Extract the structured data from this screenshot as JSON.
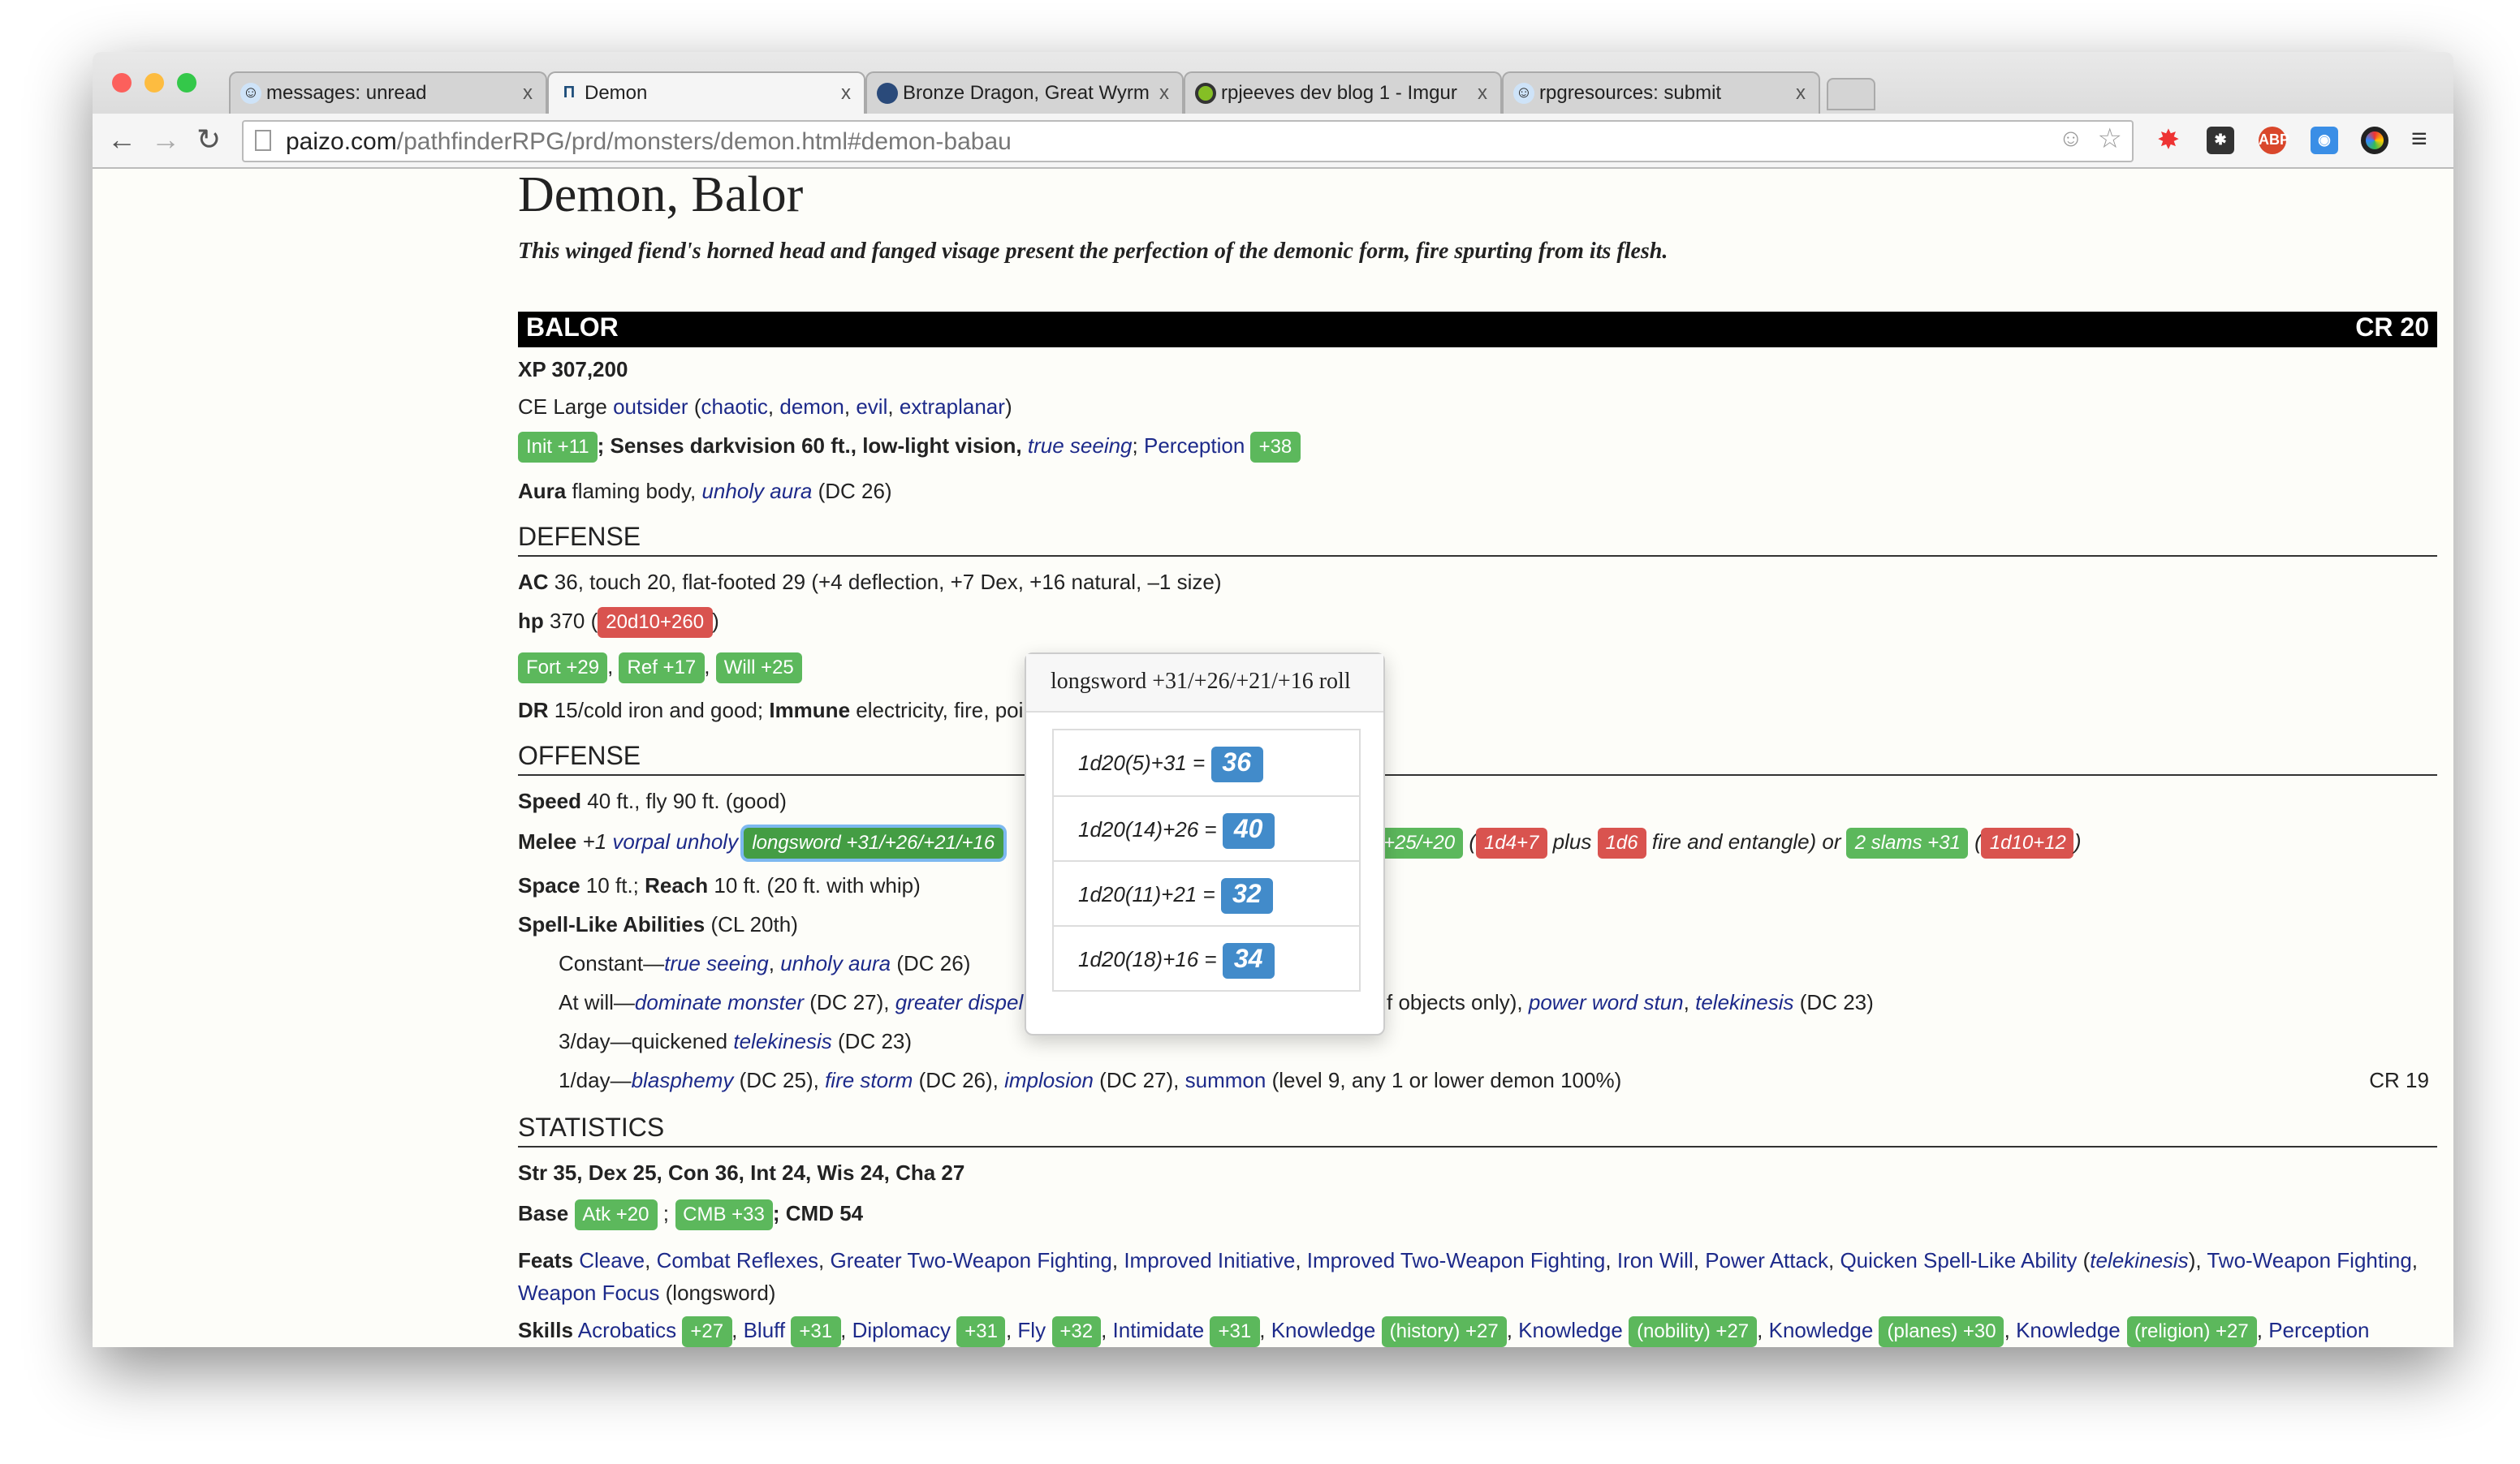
{
  "browser": {
    "tabs": [
      {
        "title": "messages: unread",
        "active": false
      },
      {
        "title": "Demon",
        "active": true
      },
      {
        "title": "Bronze Dragon, Great Wyrm",
        "active": false
      },
      {
        "title": "rpjeeves dev blog 1 - Imgur",
        "active": false
      },
      {
        "title": "rpgresources: submit",
        "active": false
      }
    ],
    "close": "x",
    "url_host": "paizo.com",
    "url_path": "/pathfinderRPG/prd/monsters/demon.html#demon-babau"
  },
  "page": {
    "title": "Demon, Balor",
    "subtitle": "This winged fiend's horned head and fanged visage present the perfection of the demonic form, fire spurting from its flesh.",
    "name": "BALOR",
    "cr": "CR 20",
    "xp": "XP 307,200",
    "type_pre": "CE Large ",
    "type": "outsider",
    "sub": [
      "chaotic",
      "demon",
      "evil",
      "extraplanar"
    ],
    "init": "Init +11",
    "senses": "; Senses darkvision 60 ft., low-light vision, ",
    "true_seeing": "true seeing",
    "perception": "Perception",
    "perception_val": "+38",
    "aura_label": "Aura",
    "aura": " flaming body, ",
    "unholy_aura": "unholy aura",
    "aura_dc": " (DC 26)",
    "defense": "DEFENSE",
    "ac_label": "AC",
    "ac": " 36, touch 20, flat-footed 29 (+4 deflection, +7 Dex, +16 natural, –1 size)",
    "hp_label": "hp",
    "hp": " 370 (",
    "hp_roll": "20d10+260",
    "fort": "Fort +29",
    "ref": "Ref +17",
    "will": "Will +25",
    "dr_label": "DR",
    "dr": " 15/cold iron and good; ",
    "immune_label": "Immune",
    "immune": " electricity, fire, poi",
    "offense": "OFFENSE",
    "speed_label": "Speed",
    "speed": " 40 ft., fly 90 ft. (good)",
    "melee_label": "Melee",
    "melee_pre": " +1 ",
    "vorpal": "vorpal",
    "unholy": "unholy",
    "longsword": "longsword +31/+26/+21/+16",
    "melee_b": "+25/+20",
    "melee_dmg1": "1d4+7",
    "plus": " plus ",
    "melee_dmg2": "1d6",
    "fire": " fire and entangle) or ",
    "slams": "2 slams +31",
    "slam_dmg": "1d10+12",
    "space": "Space",
    "space_v": " 10 ft.; ",
    "reach": "Reach",
    "reach_v": " 10 ft. (20 ft. with whip)",
    "sla": "Spell-Like Abilities",
    "sla_cl": " (CL 20th)",
    "constant": "Constant—",
    "c1": "true seeing",
    "c2": "unholy aura",
    "c_dc": " (DC 26)",
    "atwill": "At will—",
    "aw1": "dominate monster",
    "aw1dc": " (DC 27), ",
    "aw2": "greater dispel m",
    "aw_right": "f objects only), ",
    "aw3": "power word stun",
    "aw4": "telekinesis",
    "aw_dc": " (DC 23)",
    "day3": "3/day—quickened ",
    "d3": "telekinesis",
    "d3dc": " (DC 23)",
    "day1": "1/day—",
    "d1a": "blasphemy",
    "d1adc": " (DC 25), ",
    "d1b": "fire storm",
    "d1bdc": " (DC 26), ",
    "d1c": "implosion",
    "d1cdc": " (DC 27), ",
    "d1d": "summon",
    "d1ddc": " (level 9, any 1 or lower demon 100%)",
    "cr19": "CR 19",
    "statistics": "STATISTICS",
    "abilities": "Str 35, Dex 25, Con 36, Int 24, Wis 24, Cha 27",
    "base": "Base",
    "atk": "Atk +20",
    "cmb": "CMB +33",
    "cmd": "; CMD 54",
    "feats_label": "Feats",
    "feats": [
      "Cleave",
      "Combat Reflexes",
      "Greater Two-Weapon Fighting",
      "Improved Initiative",
      "Improved Two-Weapon Fighting",
      "Iron Will",
      "Power Attack",
      "Quicken Spell-Like Ability"
    ],
    "feat_tk": "telekinesis",
    "feat_twf": "Two-Weapon Fighting",
    "feat_wf": "Weapon Focus",
    "feat_wf_note": " (longsword)",
    "skills_label": "Skills",
    "skills": [
      {
        "n": "Acrobatics",
        "v": "+27"
      },
      {
        "n": "Bluff",
        "v": "+31"
      },
      {
        "n": "Diplomacy",
        "v": "+31"
      },
      {
        "n": "Fly",
        "v": "+32"
      },
      {
        "n": "Intimidate",
        "v": "+31"
      },
      {
        "n": "Knowledge",
        "v": "(history) +27"
      },
      {
        "n": "Knowledge",
        "v": "(nobility) +27"
      },
      {
        "n": "Knowledge",
        "v": "(planes) +30"
      },
      {
        "n": "Knowledge",
        "v": "(religion) +27"
      }
    ],
    "skill_last": "Perception"
  },
  "popup": {
    "title": "longsword +31/+26/+21/+16 roll",
    "rolls": [
      {
        "expr": "1d20(5)+31 =",
        "total": "36"
      },
      {
        "expr": "1d20(14)+26 =",
        "total": "40"
      },
      {
        "expr": "1d20(11)+21 =",
        "total": "32"
      },
      {
        "expr": "1d20(18)+16 =",
        "total": "34"
      }
    ]
  },
  "colors": {
    "green": "#5cb85c",
    "red": "#d9534f",
    "blue": "#428bca",
    "link": "#1d2a8a"
  }
}
